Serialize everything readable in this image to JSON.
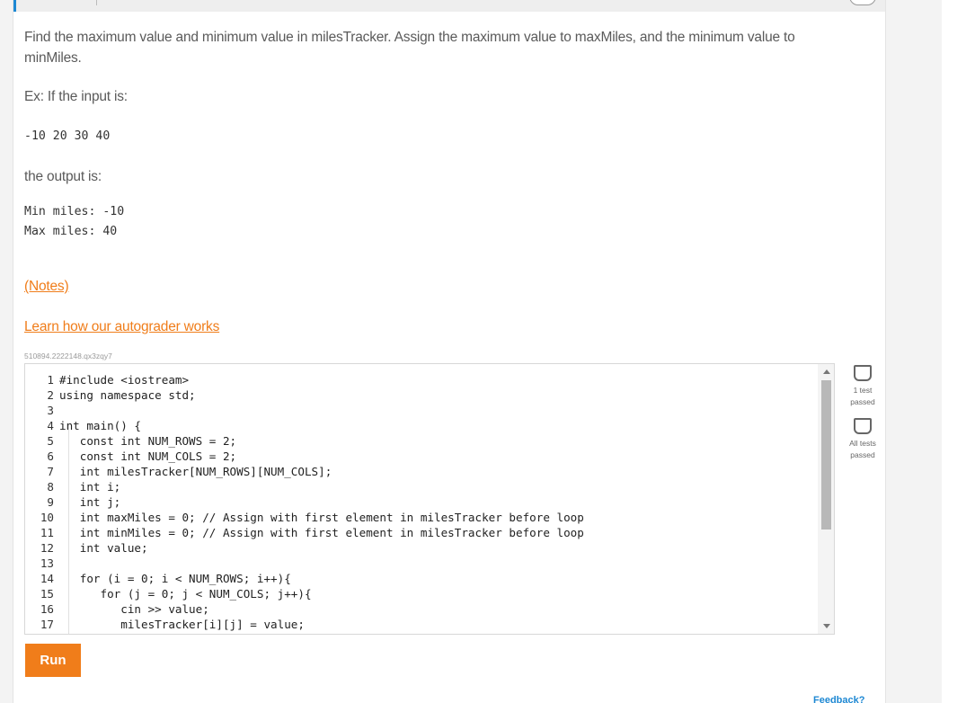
{
  "problem": {
    "description": "Find the maximum value and minimum value in milesTracker. Assign the maximum value to maxMiles, and the minimum value to minMiles.",
    "example_intro": "Ex: If the input is:",
    "example_input": "-10 20 30 40",
    "output_intro": "the output is:",
    "example_output_line1": "Min miles: -10",
    "example_output_line2": "Max miles: 40",
    "notes_link": "(Notes)",
    "autograder_link": "Learn how our autograder works",
    "problem_id": "510894.2222148.qx3zqy7"
  },
  "editor": {
    "lines": [
      {
        "num": "1",
        "text": "#include <iostream>"
      },
      {
        "num": "2",
        "text": "using namespace std;"
      },
      {
        "num": "3",
        "text": ""
      },
      {
        "num": "4",
        "text": "int main() {"
      },
      {
        "num": "5",
        "text": "   const int NUM_ROWS = 2;"
      },
      {
        "num": "6",
        "text": "   const int NUM_COLS = 2;"
      },
      {
        "num": "7",
        "text": "   int milesTracker[NUM_ROWS][NUM_COLS];"
      },
      {
        "num": "8",
        "text": "   int i;"
      },
      {
        "num": "9",
        "text": "   int j;"
      },
      {
        "num": "10",
        "text": "   int maxMiles = 0; // Assign with first element in milesTracker before loop"
      },
      {
        "num": "11",
        "text": "   int minMiles = 0; // Assign with first element in milesTracker before loop"
      },
      {
        "num": "12",
        "text": "   int value;"
      },
      {
        "num": "13",
        "text": ""
      },
      {
        "num": "14",
        "text": "   for (i = 0; i < NUM_ROWS; i++){"
      },
      {
        "num": "15",
        "text": "      for (j = 0; j < NUM_COLS; j++){"
      },
      {
        "num": "16",
        "text": "         cin >> value;"
      },
      {
        "num": "17",
        "text": "         milesTracker[i][j] = value;"
      }
    ],
    "scroll_position": 0.0
  },
  "actions": {
    "run_label": "Run"
  },
  "tests": [
    {
      "line1": "1 test",
      "line2": "passed",
      "checked": false
    },
    {
      "line1": "All tests",
      "line2": "passed",
      "checked": false
    }
  ],
  "feedback_label": "Feedback?",
  "colors": {
    "accent": "#f07d1a",
    "link": "#f07d1a",
    "brand_blue": "#1e88d3"
  }
}
